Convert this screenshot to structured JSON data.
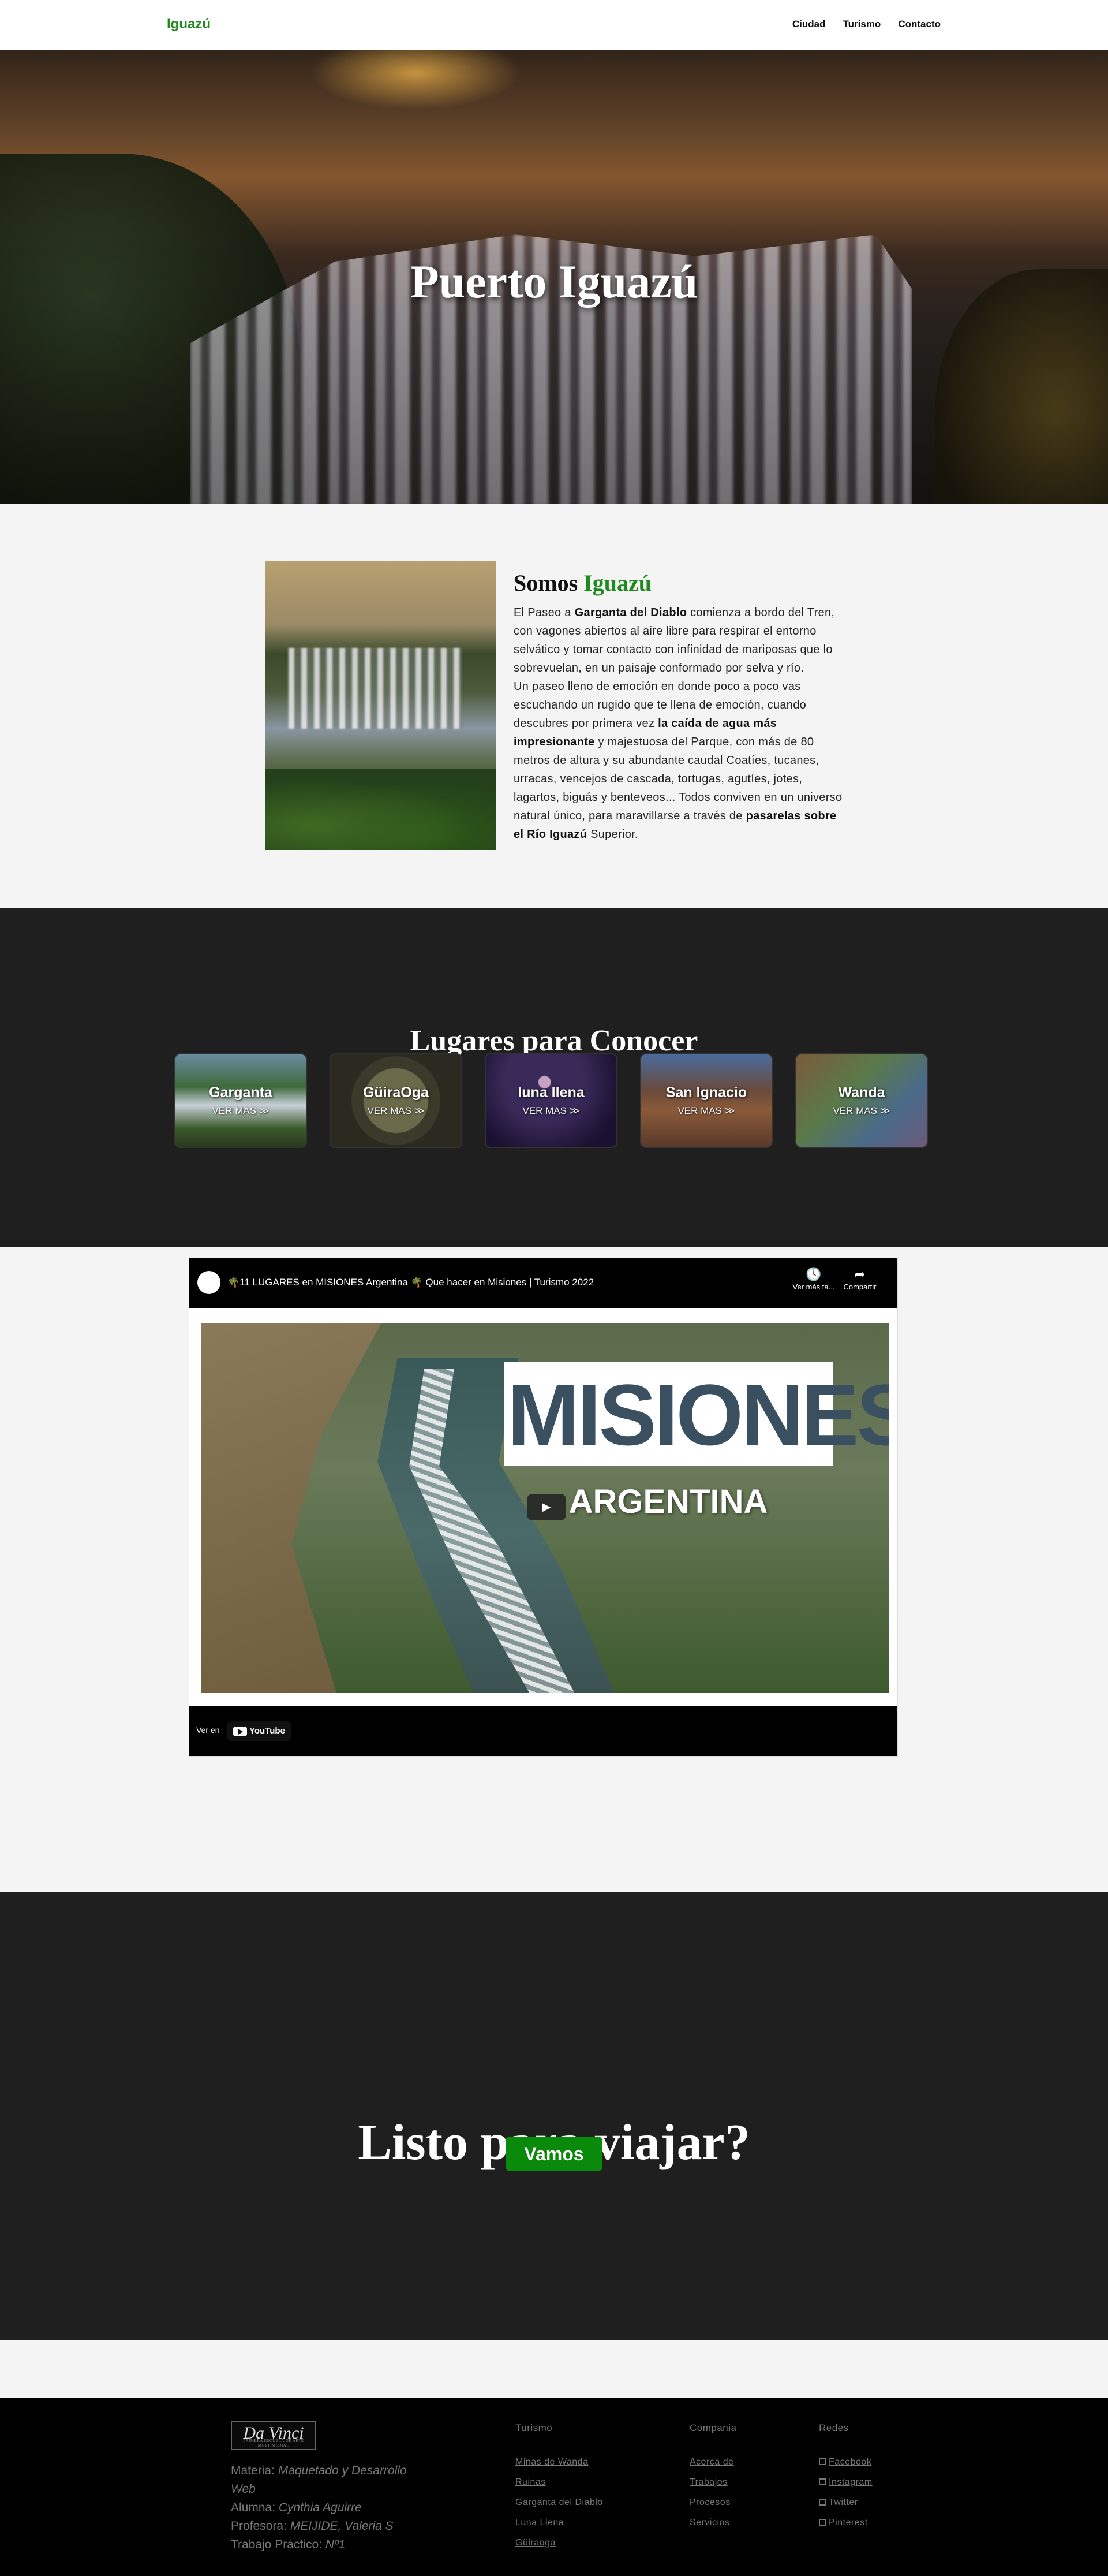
{
  "nav": {
    "brand": "Iguazú",
    "links": [
      "Ciudad",
      "Turismo",
      "Contacto"
    ]
  },
  "hero": {
    "title": "Puerto Iguazú"
  },
  "about": {
    "title_prefix": "Somos ",
    "title_accent": "Iguazú",
    "p1_a": "El Paseo a ",
    "p1_b": "Garganta del Diablo",
    "p1_c": " comienza a bordo del Tren, con vagones abiertos al aire libre para respirar el entorno selvático y tomar contacto con infinidad de mariposas que lo sobrevuelan, en un paisaje conformado por selva y río.",
    "p2_a": "Un paseo lleno de emoción en donde poco a poco vas escuchando un rugido que te llena de emoción, cuando descubres por primera vez ",
    "p2_b": "la caída de agua más impresionante",
    "p2_c": " y majestuosa del Parque, con más de 80 metros de altura y su abundante caudal Coatíes, tucanes, urracas, vencejos de cascada, tortugas, agutíes, jotes, lagartos, biguás y benteveos... Todos conviven en un universo natural único, para maravillarse a través de ",
    "p2_d": "pasarelas sobre el Río Iguazú",
    "p2_e": " Superior."
  },
  "places": {
    "title": "Lugares para Conocer",
    "more_label": "VER MAS ≫",
    "cards": [
      {
        "name": "Garganta"
      },
      {
        "name": "GüiraOga"
      },
      {
        "name": "luna llena"
      },
      {
        "name": "San Ignacio"
      },
      {
        "name": "Wanda"
      }
    ]
  },
  "video": {
    "title": "🌴11 LUGARES en MISIONES Argentina 🌴 Que hacer en Misiones | Turismo 2022",
    "watch_later": "Ver más ta...",
    "share": "Compartir",
    "thumb_title": "MISIONES",
    "thumb_subtitle": "ARGENTINA",
    "watch_on": "Ver en",
    "youtube": "YouTube"
  },
  "cta": {
    "title": "Listo para viajar?",
    "button": "Vamos"
  },
  "footer": {
    "logo_text": "Da Vinci",
    "logo_sub": "PRIMERA ESCUELA DE ARTE MULTIMEDIAL",
    "materia_label": "Materia: ",
    "materia": "Maquetado y Desarrollo Web",
    "alumna_label": "Alumna: ",
    "alumna": "Cynthia Aguirre",
    "profesora_label": "Profesora: ",
    "profesora": "MEIJIDE, Valeria S",
    "tp_label": "Trabajo Practico: ",
    "tp": "Nº1",
    "turismo": {
      "title": "Turismo",
      "links": [
        "Minas de Wanda",
        "Ruinas",
        "Garganta del Diablo",
        "Luna Llena",
        "Güiraoga"
      ]
    },
    "compania": {
      "title": "Compania",
      "links": [
        "Acerca de",
        "Trabajos",
        "Procesos",
        "Servicios"
      ]
    },
    "redes": {
      "title": "Redes",
      "links": [
        "Facebook",
        "Instagram",
        "Twitter",
        "Pinterest"
      ]
    }
  }
}
